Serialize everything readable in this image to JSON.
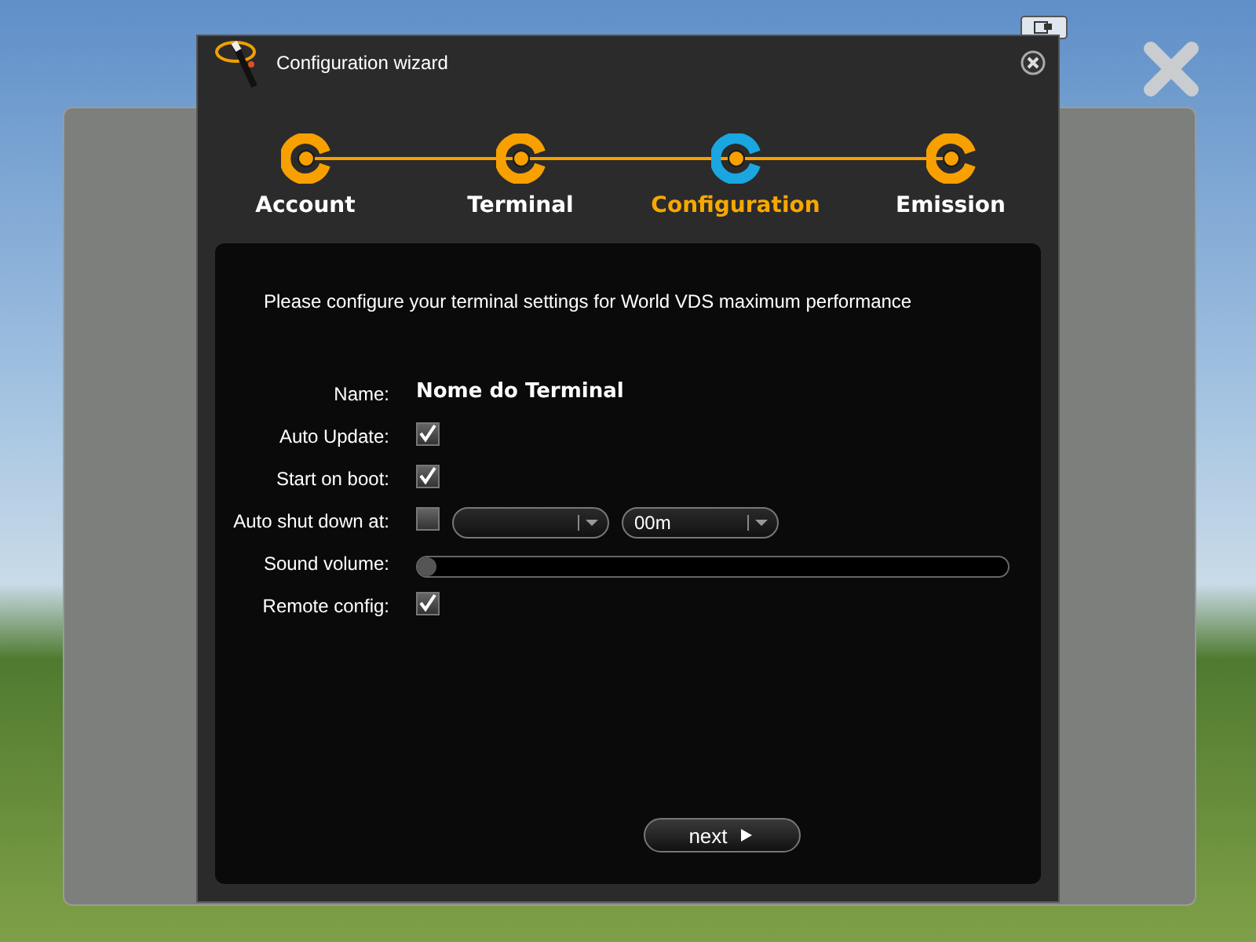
{
  "window": {
    "title": "Configuration wizard"
  },
  "steps": [
    {
      "label": "Account",
      "selected": false
    },
    {
      "label": "Terminal",
      "selected": false
    },
    {
      "label": "Configuration",
      "selected": true
    },
    {
      "label": "Emission",
      "selected": false
    }
  ],
  "intro": "Please configure your terminal settings for World VDS maximum performance",
  "fields": [
    {
      "kind": "text",
      "label": "Name:",
      "value": "Nome do Terminal"
    },
    {
      "kind": "checkbox",
      "label": "Auto Update:",
      "checked": true
    },
    {
      "kind": "checkbox",
      "label": "Start on boot:",
      "checked": true
    },
    {
      "kind": "shutdown",
      "label": "Auto shut down at:",
      "checked": false,
      "minutes": "00m"
    },
    {
      "kind": "slider",
      "label": "Sound volume:",
      "level": 0
    },
    {
      "kind": "checkbox",
      "label": "Remote config:",
      "checked": true
    }
  ],
  "next_button": {
    "label": "next"
  }
}
